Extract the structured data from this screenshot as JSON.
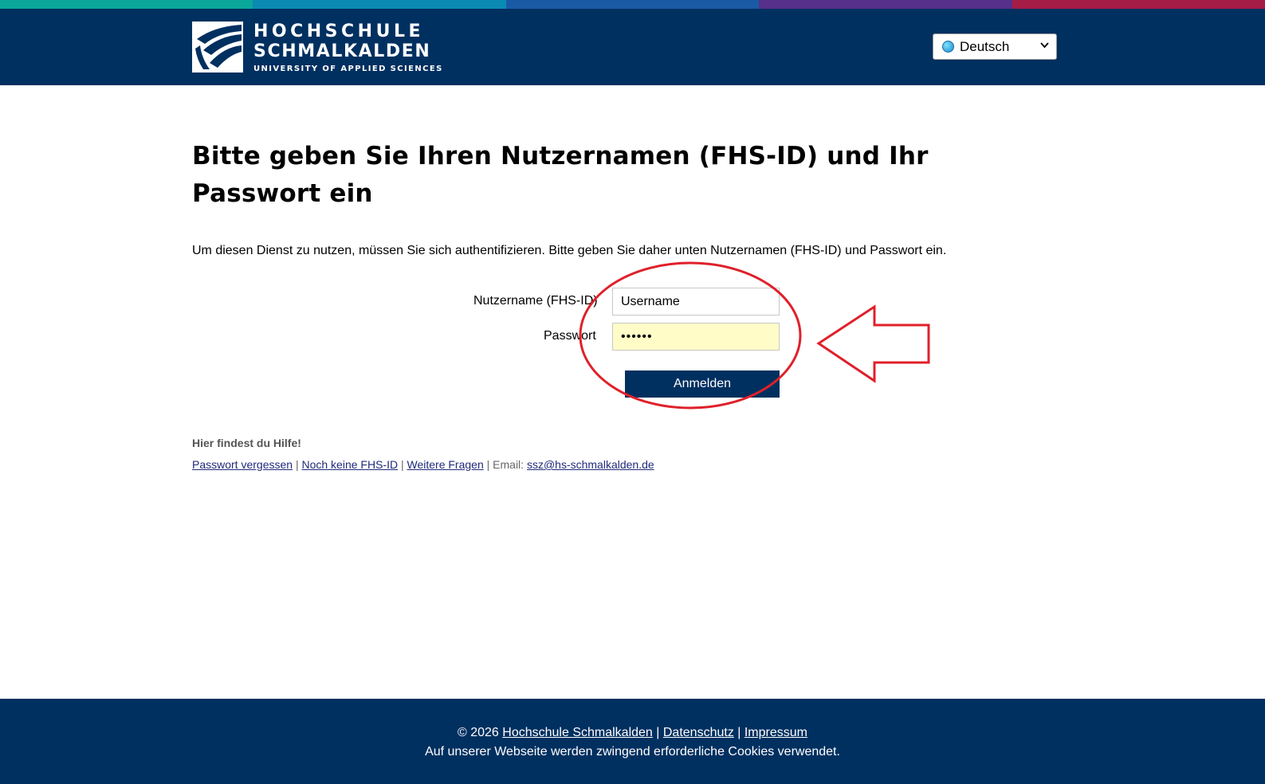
{
  "colors": {
    "stripe": [
      "#0aa79a",
      "#0b8ab4",
      "#1a5aa5",
      "#56308a",
      "#a51c47"
    ],
    "brand_navy": "#003060",
    "annotation_red": "#e0202a"
  },
  "header": {
    "logo": {
      "line1": "HOCHSCHULE",
      "line2": "SCHMALKALDEN",
      "line3": "UNIVERSITY OF APPLIED SCIENCES"
    },
    "language": {
      "selected": "Deutsch",
      "icon": "globe-icon"
    }
  },
  "main": {
    "heading": "Bitte geben Sie Ihren Nutzernamen (FHS-ID) und Ihr Passwort ein",
    "intro": "Um diesen Dienst zu nutzen, müssen Sie sich authentifizieren. Bitte geben Sie daher unten Nutzernamen (FHS-ID) und Passwort ein.",
    "form": {
      "username_label": "Nutzername (FHS-ID)",
      "username_value": "Username",
      "password_label": "Passwort",
      "password_value": "••••••",
      "submit_label": "Anmelden"
    },
    "help": {
      "title": "Hier findest du Hilfe!",
      "forgot_password": "Passwort vergessen",
      "no_id": "Noch keine FHS-ID",
      "more_questions": "Weitere Fragen",
      "sep": " | ",
      "email_label": "Email: ",
      "email": "ssz@hs-schmalkalden.de"
    }
  },
  "footer": {
    "copyright": "© 2026 ",
    "org_link": "Hochschule Schmalkalden",
    "sep": " | ",
    "privacy_link": "Datenschutz",
    "imprint_link": "Impressum",
    "cookie_notice": "Auf unserer Webseite werden zwingend erforderliche Cookies verwendet."
  }
}
